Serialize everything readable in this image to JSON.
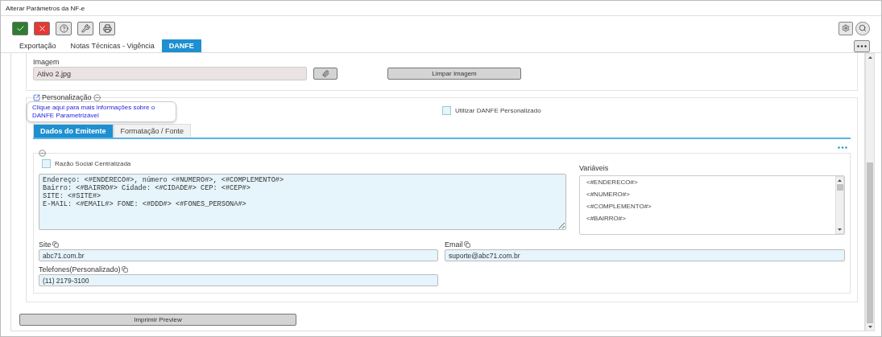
{
  "window": {
    "title": "Alterar Parâmetros da NF-e"
  },
  "toolbar": [
    {
      "kind": "confirm"
    },
    {
      "kind": "cancel"
    },
    {
      "kind": "help"
    },
    {
      "kind": "tools"
    },
    {
      "kind": "print"
    }
  ],
  "tabs": [
    {
      "label": "Exportação",
      "selected": false
    },
    {
      "label": "Notas Técnicas - Vigência",
      "selected": false
    },
    {
      "label": "DANFE",
      "selected": true
    }
  ],
  "image": {
    "label": "Imagem",
    "value": "Ativo 2.jpg",
    "clear_button": "Limpar Imagem"
  },
  "personalization": {
    "legend": "Personalização",
    "tooltip": "Clique aqui para mais informações sobre o DANFE Parametrizável",
    "use_custom": {
      "label": "Utilizar DANFE Personalizado",
      "checked": false
    },
    "tabs": [
      {
        "label": "Dados do Emitente",
        "selected": true
      },
      {
        "label": "Formatação / Fonte",
        "selected": false
      }
    ],
    "centered_name": {
      "label": "Razão Social Centralizada",
      "checked": false
    },
    "template": "Endereço: <#ENDERECO#>, número <#NUMERO#>, <#COMPLEMENTO#>\nBairro: <#BAIRRO#> Cidade: <#CIDADE#> CEP: <#CEP#>\nSITE: <#SITE#>\nE-MAIL: <#EMAIL#> FONE: <#DDD#> <#FONES_PERSONA#>",
    "variables": {
      "label": "Variáveis",
      "items": [
        "<#ENDERECO#>",
        "<#NUMERO#>",
        "<#COMPLEMENTO#>",
        "<#BAIRRO#>"
      ]
    },
    "site": {
      "label": "Site",
      "value": "abc71.com.br"
    },
    "email": {
      "label": "Email",
      "value": "suporte@abc71.com.br"
    },
    "phones": {
      "label": "Telefones(Personalizado)",
      "value": "(11) 2179-3100"
    }
  },
  "print_button": "Imprimir Preview"
}
